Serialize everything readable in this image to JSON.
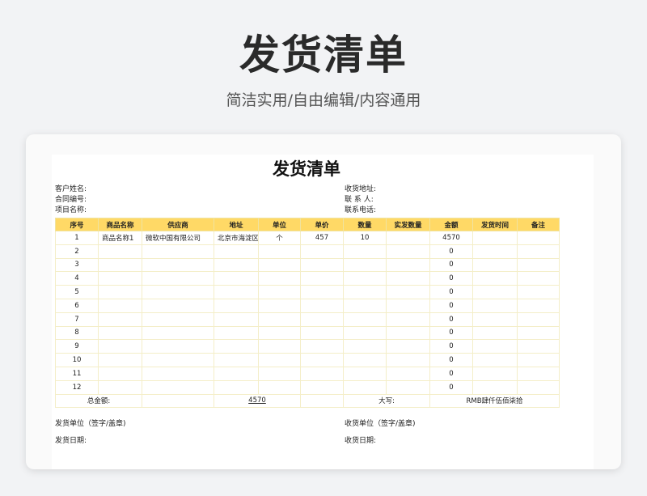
{
  "hero": {
    "title": "发货清单",
    "subtitle": "简洁实用/自由编辑/内容通用"
  },
  "sheet": {
    "title": "发货清单",
    "info_left": [
      "客户姓名:",
      "合同编号:",
      "项目名称:"
    ],
    "info_right": [
      "收货地址:",
      "联 系 人:",
      "联系电话:"
    ],
    "headers": [
      "序号",
      "商品名称",
      "供应商",
      "地址",
      "单位",
      "单价",
      "数量",
      "实发数量",
      "金额",
      "发货时间",
      "备注"
    ],
    "rows": [
      [
        "1",
        "商品名称1",
        "微软中国有限公司",
        "北京市海淀区",
        "个",
        "457",
        "10",
        "",
        "4570",
        "",
        ""
      ],
      [
        "2",
        "",
        "",
        "",
        "",
        "",
        "",
        "",
        "0",
        "",
        ""
      ],
      [
        "3",
        "",
        "",
        "",
        "",
        "",
        "",
        "",
        "0",
        "",
        ""
      ],
      [
        "4",
        "",
        "",
        "",
        "",
        "",
        "",
        "",
        "0",
        "",
        ""
      ],
      [
        "5",
        "",
        "",
        "",
        "",
        "",
        "",
        "",
        "0",
        "",
        ""
      ],
      [
        "6",
        "",
        "",
        "",
        "",
        "",
        "",
        "",
        "0",
        "",
        ""
      ],
      [
        "7",
        "",
        "",
        "",
        "",
        "",
        "",
        "",
        "0",
        "",
        ""
      ],
      [
        "8",
        "",
        "",
        "",
        "",
        "",
        "",
        "",
        "0",
        "",
        ""
      ],
      [
        "9",
        "",
        "",
        "",
        "",
        "",
        "",
        "",
        "0",
        "",
        ""
      ],
      [
        "10",
        "",
        "",
        "",
        "",
        "",
        "",
        "",
        "0",
        "",
        ""
      ],
      [
        "11",
        "",
        "",
        "",
        "",
        "",
        "",
        "",
        "0",
        "",
        ""
      ],
      [
        "12",
        "",
        "",
        "",
        "",
        "",
        "",
        "",
        "0",
        "",
        ""
      ]
    ],
    "total": {
      "label": "总金额:",
      "value": "4570",
      "caps_label": "大写:",
      "caps_value": "RMB肆仟伍佰柒拾"
    },
    "footer": {
      "sender_unit": "发货单位（签字/盖章)",
      "receiver_unit": "收货单位（签字/盖章)",
      "ship_date": "发货日期:",
      "receive_date": "收货日期:"
    }
  }
}
